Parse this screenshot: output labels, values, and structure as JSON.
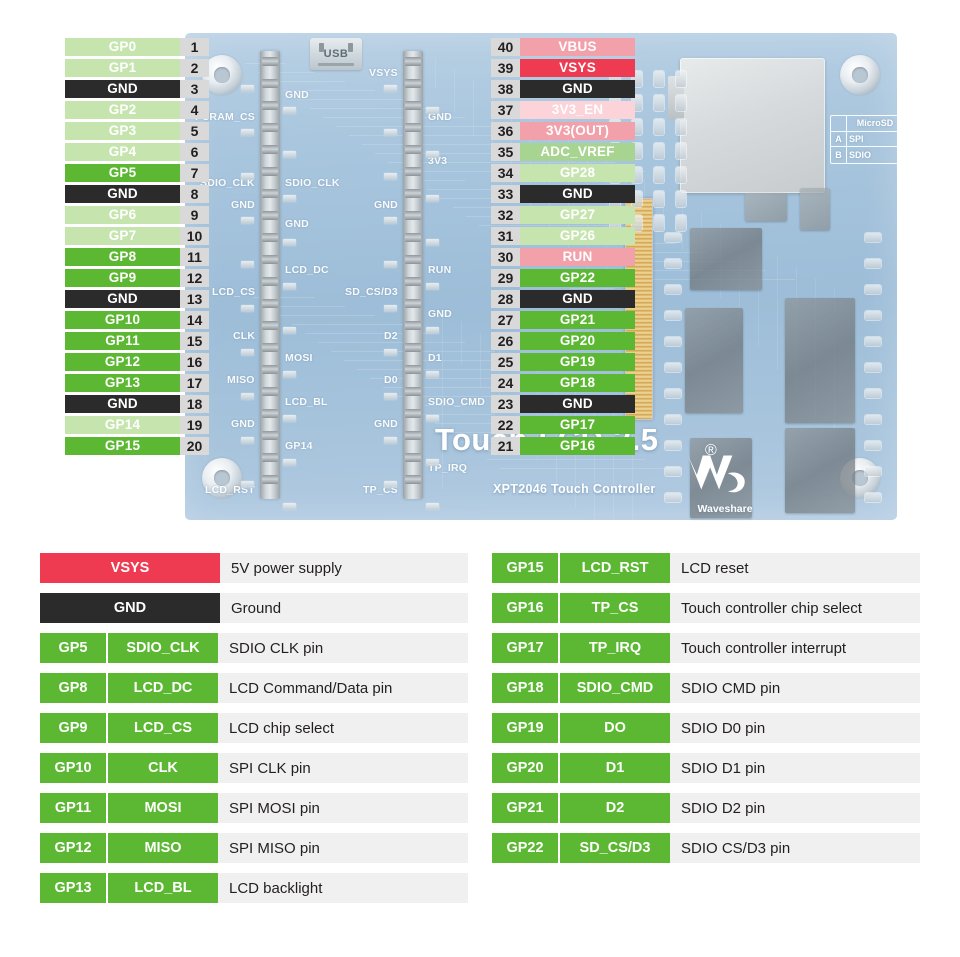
{
  "board": {
    "title": "Touch-LCD-3.5",
    "registered_mark": "®",
    "subtitle": "XPT2046 Touch Controller",
    "vendor": "Waveshare",
    "usb_label": "USB",
    "microsd_legend": {
      "header": "MicroSD",
      "rows": [
        {
          "key": "A",
          "value": "SPI"
        },
        {
          "key": "B",
          "value": "SDIO"
        }
      ]
    },
    "silkscreen_left": [
      "PSRAM_CS",
      "SDIO_CLK",
      "GND",
      "LCD_DC",
      "LCD_CS",
      "CLK",
      "MOSI",
      "MISO",
      "LCD_BL",
      "GND",
      "GP14",
      "LCD_RST"
    ],
    "silkscreen_left_inner": [
      "GND",
      "SDIO_CLK",
      "LCD_DC",
      "GND",
      "MOSI",
      "LCD_BL",
      "GP14"
    ],
    "silkscreen_mid": [
      "VSYS",
      "GND",
      "3V3",
      "GND",
      "RUN",
      "SD_CS/D3",
      "D2",
      "D0",
      "GND",
      "TP_CS"
    ],
    "silkscreen_mid_inner": [
      "GND",
      "3V3",
      "RUN",
      "GND",
      "D1",
      "SDIO_CMD",
      "TP_IRQ"
    ]
  },
  "pins_left": [
    {
      "num": "1",
      "label": "GP0",
      "color": "c-pgreen"
    },
    {
      "num": "2",
      "label": "GP1",
      "color": "c-pgreen"
    },
    {
      "num": "3",
      "label": "GND",
      "color": "c-gnd"
    },
    {
      "num": "4",
      "label": "GP2",
      "color": "c-pgreen"
    },
    {
      "num": "5",
      "label": "GP3",
      "color": "c-pgreen"
    },
    {
      "num": "6",
      "label": "GP4",
      "color": "c-pgreen"
    },
    {
      "num": "7",
      "label": "GP5",
      "color": "c-green"
    },
    {
      "num": "8",
      "label": "GND",
      "color": "c-gnd"
    },
    {
      "num": "9",
      "label": "GP6",
      "color": "c-pgreen"
    },
    {
      "num": "10",
      "label": "GP7",
      "color": "c-pgreen"
    },
    {
      "num": "11",
      "label": "GP8",
      "color": "c-green"
    },
    {
      "num": "12",
      "label": "GP9",
      "color": "c-green"
    },
    {
      "num": "13",
      "label": "GND",
      "color": "c-gnd"
    },
    {
      "num": "14",
      "label": "GP10",
      "color": "c-green"
    },
    {
      "num": "15",
      "label": "GP11",
      "color": "c-green"
    },
    {
      "num": "16",
      "label": "GP12",
      "color": "c-green"
    },
    {
      "num": "17",
      "label": "GP13",
      "color": "c-green"
    },
    {
      "num": "18",
      "label": "GND",
      "color": "c-gnd"
    },
    {
      "num": "19",
      "label": "GP14",
      "color": "c-pgreen"
    },
    {
      "num": "20",
      "label": "GP15",
      "color": "c-green"
    }
  ],
  "pins_right": [
    {
      "num": "40",
      "label": "VBUS",
      "color": "c-pred"
    },
    {
      "num": "39",
      "label": "VSYS",
      "color": "c-vsys"
    },
    {
      "num": "38",
      "label": "GND",
      "color": "c-gnd"
    },
    {
      "num": "37",
      "label": "3V3_EN",
      "color": "c-ppink"
    },
    {
      "num": "36",
      "label": "3V3(OUT)",
      "color": "c-pred"
    },
    {
      "num": "35",
      "label": "ADC_VREF",
      "color": "c-adc"
    },
    {
      "num": "34",
      "label": "GP28",
      "color": "c-pgreen"
    },
    {
      "num": "33",
      "label": "GND",
      "color": "c-gnd"
    },
    {
      "num": "32",
      "label": "GP27",
      "color": "c-pgreen"
    },
    {
      "num": "31",
      "label": "GP26",
      "color": "c-pgreen"
    },
    {
      "num": "30",
      "label": "RUN",
      "color": "c-pred"
    },
    {
      "num": "29",
      "label": "GP22",
      "color": "c-green"
    },
    {
      "num": "28",
      "label": "GND",
      "color": "c-gnd"
    },
    {
      "num": "27",
      "label": "GP21",
      "color": "c-green"
    },
    {
      "num": "26",
      "label": "GP20",
      "color": "c-green"
    },
    {
      "num": "25",
      "label": "GP19",
      "color": "c-green"
    },
    {
      "num": "24",
      "label": "GP18",
      "color": "c-green"
    },
    {
      "num": "23",
      "label": "GND",
      "color": "c-gnd"
    },
    {
      "num": "22",
      "label": "GP17",
      "color": "c-green"
    },
    {
      "num": "21",
      "label": "GP16",
      "color": "c-green"
    }
  ],
  "legend_left": [
    {
      "gp": null,
      "fn": "VSYS",
      "desc": "5V power supply",
      "color": "c-vsys"
    },
    {
      "gp": null,
      "fn": "GND",
      "desc": "Ground",
      "color": "c-gnd"
    },
    {
      "gp": "GP5",
      "fn": "SDIO_CLK",
      "desc": "SDIO CLK pin",
      "color": "c-green"
    },
    {
      "gp": "GP8",
      "fn": "LCD_DC",
      "desc": "LCD Command/Data pin",
      "color": "c-green"
    },
    {
      "gp": "GP9",
      "fn": "LCD_CS",
      "desc": "LCD chip select",
      "color": "c-green"
    },
    {
      "gp": "GP10",
      "fn": "CLK",
      "desc": "SPI CLK pin",
      "color": "c-green"
    },
    {
      "gp": "GP11",
      "fn": "MOSI",
      "desc": "SPI MOSI pin",
      "color": "c-green"
    },
    {
      "gp": "GP12",
      "fn": "MISO",
      "desc": "SPI MISO pin",
      "color": "c-green"
    },
    {
      "gp": "GP13",
      "fn": "LCD_BL",
      "desc": "LCD backlight",
      "color": "c-green"
    }
  ],
  "legend_right": [
    {
      "gp": "GP15",
      "fn": "LCD_RST",
      "desc": "LCD reset",
      "color": "c-green"
    },
    {
      "gp": "GP16",
      "fn": "TP_CS",
      "desc": "Touch controller chip select",
      "color": "c-green"
    },
    {
      "gp": "GP17",
      "fn": "TP_IRQ",
      "desc": "Touch controller interrupt",
      "color": "c-green"
    },
    {
      "gp": "GP18",
      "fn": "SDIO_CMD",
      "desc": "SDIO CMD pin",
      "color": "c-green"
    },
    {
      "gp": "GP19",
      "fn": "DO",
      "desc": "SDIO D0 pin",
      "color": "c-green"
    },
    {
      "gp": "GP20",
      "fn": "D1",
      "desc": "SDIO D1 pin",
      "color": "c-green"
    },
    {
      "gp": "GP21",
      "fn": "D2",
      "desc": "SDIO D2 pin",
      "color": "c-green"
    },
    {
      "gp": "GP22",
      "fn": "SD_CS/D3",
      "desc": "SDIO CS/D3 pin",
      "color": "c-green"
    }
  ],
  "colors": {
    "green": "#5cb832",
    "pale_green": "#c6e5ae",
    "gnd_black": "#2b2b2b",
    "vsys_red": "#ef3b52",
    "pale_red": "#f2a0aa",
    "pale_pink": "#fbd3d8",
    "adc_green": "#a8d492",
    "pcb_blue": "#a9c6de",
    "pin_number_bg": "#d9d9d9",
    "legend_row_bg": "#f0f0f0"
  }
}
